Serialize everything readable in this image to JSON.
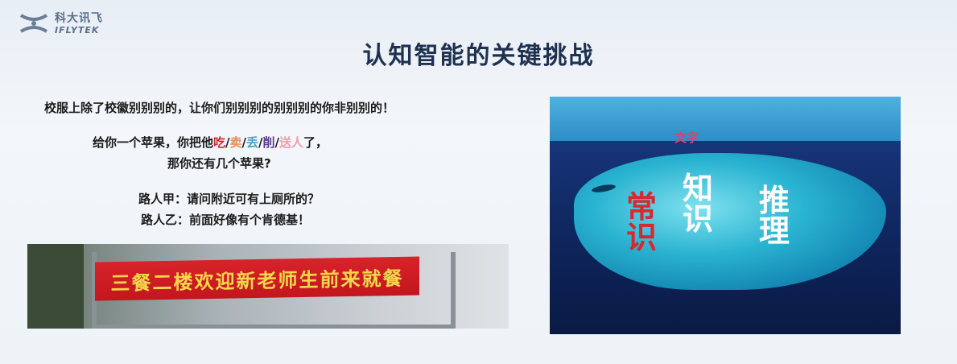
{
  "logo": {
    "cn": "科大讯飞",
    "en": "IFLYTEK"
  },
  "title": "认知智能的关键挑战",
  "lines": {
    "line1": "校服上除了校徽别别别的，让你们别别别的别别别的你非别别的！",
    "line2_prefix": "给你一个苹果，你把他",
    "words": [
      "吃",
      "卖",
      "丢",
      "削",
      "送人"
    ],
    "separator": "/",
    "line2_suffix": "了，",
    "line3": "那你还有几个苹果?",
    "line4": "路人甲：请问附近可有上厕所的？",
    "line5": "路人乙：前面好像有个肯德基！"
  },
  "photo": {
    "banner_text": "三餐二楼欢迎新老师生前来就餐"
  },
  "iceberg": {
    "surface_label": "文字",
    "words": [
      "常识",
      "知识",
      "推理"
    ]
  },
  "colors": {
    "eat": "#d0262f",
    "sell": "#e78a4e",
    "lose": "#4aa3c8",
    "peel": "#5a3a8a",
    "give": "#e8a0a8"
  }
}
